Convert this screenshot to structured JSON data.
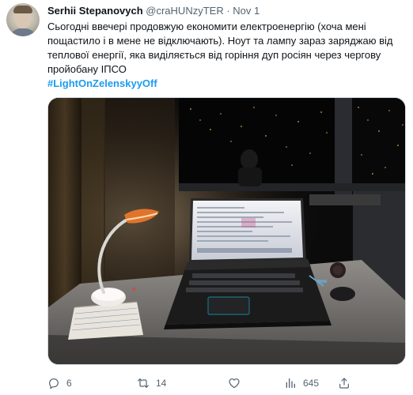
{
  "tweet": {
    "author": {
      "display_name": "Serhii Stepanovych",
      "handle": "@craHUNzyTER",
      "separator": "·",
      "date": "Nov 1"
    },
    "text_lines": [
      "Сьогодні ввечері продовжую економити електроенергію (хоча мені",
      "пощастило і в мене не відключають). Ноут та лампу зараз заряджаю від",
      "теплової енергії, яка виділяється від горіння дуп росіян через чергову",
      "пройобану ІПСО"
    ],
    "hashtag": "#LightOnZelenskyyOff",
    "actions": {
      "replies": "6",
      "retweets": "14",
      "likes": "",
      "views": "645"
    },
    "icons": {
      "reply": "reply-icon",
      "retweet": "retweet-icon",
      "like": "heart-icon",
      "views": "views-chart-icon",
      "share": "share-icon"
    },
    "colors": {
      "accent": "#1d9bf0",
      "muted": "#536471",
      "text": "#0f1419"
    }
  }
}
